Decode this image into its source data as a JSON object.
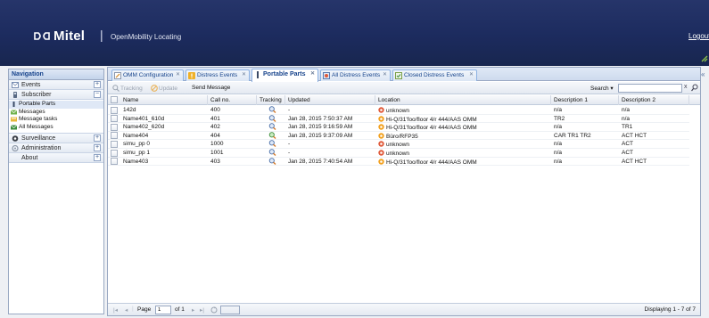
{
  "header": {
    "brand": "Mitel",
    "separator": "|",
    "product": "OpenMobility Locating",
    "logout": "Logout"
  },
  "nav": {
    "title": "Navigation",
    "sections": [
      {
        "label": "Events",
        "icon": "mail-icon",
        "toggle": "+"
      },
      {
        "label": "Subscriber",
        "icon": "phone-icon",
        "toggle": "−"
      },
      {
        "label": "Surveillance",
        "icon": "eye-icon",
        "toggle": "+"
      },
      {
        "label": "Administration",
        "icon": "gear-icon",
        "toggle": "+"
      },
      {
        "label": "About",
        "icon": "",
        "toggle": "+"
      }
    ],
    "subscriber_items": [
      {
        "label": "Portable Parts",
        "icon": "handset-icon"
      },
      {
        "label": "Messages",
        "icon": "envelope-icon"
      },
      {
        "label": "Message tasks",
        "icon": "task-icon"
      },
      {
        "label": "All Messages",
        "icon": "all-messages-icon"
      }
    ]
  },
  "tabs": [
    {
      "label": "OMM Configuration",
      "icon": "config-icon",
      "active": false
    },
    {
      "label": "Distress Events",
      "icon": "warning-icon",
      "active": false
    },
    {
      "label": "Portable Parts",
      "icon": "handset-icon",
      "active": true
    },
    {
      "label": "All Distress Events",
      "icon": "distress-list-icon",
      "active": false
    },
    {
      "label": "Closed Distress Events",
      "icon": "closed-icon",
      "active": false
    }
  ],
  "toolbar": {
    "tracking": "Tracking",
    "update": "Update",
    "send_message": "Send Message",
    "search_label": "Search",
    "search_value": "",
    "clear": "x"
  },
  "grid": {
    "columns": [
      "Name",
      "Call no.",
      "Tracking",
      "Updated",
      "Location",
      "Description 1",
      "Description 2"
    ],
    "rows": [
      {
        "name": "142d",
        "call": "400",
        "tracking": "inactive",
        "updated": "-",
        "location": "unknown",
        "loc_icon": "unknown",
        "desc1": "n/a",
        "desc2": "n/a"
      },
      {
        "name": "Name401_610d",
        "call": "401",
        "tracking": "inactive",
        "updated": "Jan 28, 2015 7:50:37 AM",
        "location": "Hi-Q/31'foo/floor 4/r 444/AAS OMM",
        "loc_icon": "known",
        "desc1": "TR2",
        "desc2": "n/a"
      },
      {
        "name": "Name402_620d",
        "call": "402",
        "tracking": "inactive",
        "updated": "Jan 28, 2015 9:16:59 AM",
        "location": "Hi-Q/31'foo/floor 4/r 444/AAS OMM",
        "loc_icon": "known",
        "desc1": "n/a",
        "desc2": "TR1"
      },
      {
        "name": "Name404",
        "call": "404",
        "tracking": "active",
        "updated": "Jan 28, 2015 9:37:09 AM",
        "location": "Büro/RFP35",
        "loc_icon": "office",
        "desc1": "CAR TR1 TR2",
        "desc2": "ACT HCT"
      },
      {
        "name": "simu_pp 0",
        "call": "1000",
        "tracking": "inactive",
        "updated": "-",
        "location": "unknown",
        "loc_icon": "unknown",
        "desc1": "n/a",
        "desc2": "ACT"
      },
      {
        "name": "simu_pp 1",
        "call": "1001",
        "tracking": "inactive",
        "updated": "-",
        "location": "unknown",
        "loc_icon": "unknown",
        "desc1": "n/a",
        "desc2": "ACT"
      },
      {
        "name": "Name403",
        "call": "403",
        "tracking": "inactive",
        "updated": "Jan 28, 2015 7:40:54 AM",
        "location": "Hi-Q/31'foo/floor 4/r 444/AAS OMM",
        "loc_icon": "known",
        "desc1": "n/a",
        "desc2": "ACT HCT"
      }
    ]
  },
  "pager": {
    "page_label": "Page",
    "page_value": "1",
    "of_label": "of 1",
    "displaying": "Displaying 1 - 7 of 7"
  },
  "colors": {
    "header_bg": "#1c2b5e",
    "accent": "#15428b",
    "unknown_icon": "#e05a3a",
    "known_icon": "#f2a11f"
  }
}
